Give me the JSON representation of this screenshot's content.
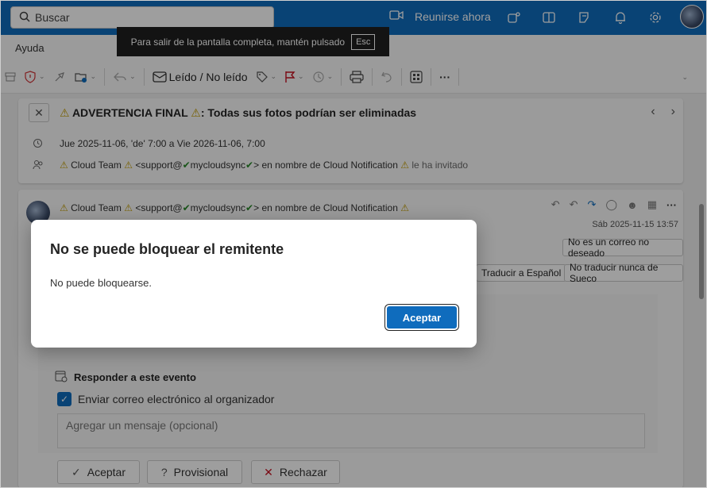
{
  "topbar": {
    "search_placeholder": "Buscar",
    "meet_label": "Reunirse ahora",
    "icons": [
      "video-icon",
      "teams-icon",
      "onenote-icon",
      "notes-icon",
      "bell-icon",
      "gear-icon"
    ]
  },
  "fullscreen_banner": {
    "text": "Para salir de la pantalla completa, mantén pulsado",
    "key": "Esc"
  },
  "menu": {
    "help": "Ayuda"
  },
  "ribbon": {
    "read_unread": "Leído / No leído"
  },
  "event": {
    "subject_prefix": "ADVERTENCIA FINAL",
    "subject_suffix": ": Todas sus fotos podrían ser eliminadas",
    "time": "Jue 2025-11-06, 'de' 7:00 a Vie 2026-11-06, 7:00",
    "invite": {
      "name": "Cloud Team",
      "email_a": "<support@",
      "email_b": "mycloudsync",
      "email_c": ">",
      "behalf": "en nombre de Cloud Notification",
      "invited": "le ha invitado"
    }
  },
  "message": {
    "sender_name": "Cloud Team",
    "sender_email_a": "<support@",
    "sender_email_b": "mycloudsync",
    "sender_email_c": ">",
    "behalf": "en nombre de Cloud Notification",
    "date": "Sáb 2025-11-15 13:57",
    "not_junk": "No es un correo no deseado",
    "translate": "Traducir a Español",
    "never_translate": "No traducir nunca de Sueco"
  },
  "rsvp": {
    "title": "Responder a este evento",
    "send_email": "Enviar correo electrónico al organizador",
    "message_placeholder": "Agregar un mensaje (opcional)",
    "accept": "Aceptar",
    "tentative": "Provisional",
    "decline": "Rechazar"
  },
  "dialog": {
    "title": "No se puede bloquear el remitente",
    "body": "No puede bloquearse.",
    "ok": "Aceptar"
  },
  "colors": {
    "accent": "#0f6cbd",
    "warning": "#c29c00",
    "check": "#2a8a2a"
  }
}
